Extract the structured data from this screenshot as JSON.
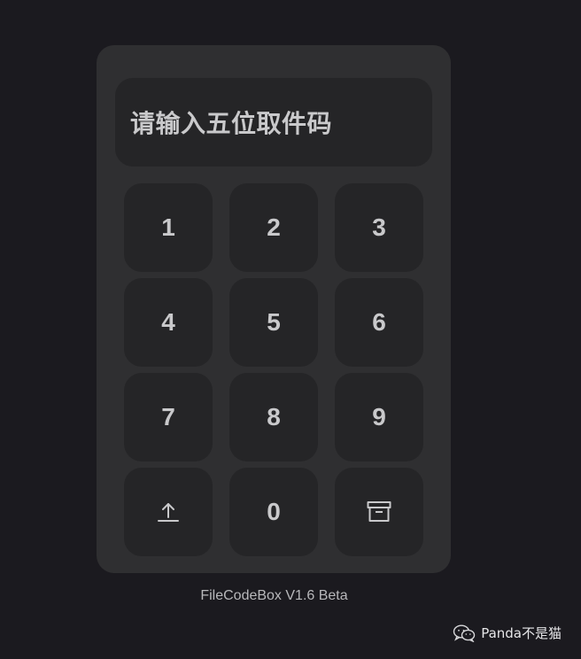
{
  "display": {
    "placeholder": "请输入五位取件码"
  },
  "keypad": {
    "keys": [
      {
        "label": "1",
        "name": "key-1"
      },
      {
        "label": "2",
        "name": "key-2"
      },
      {
        "label": "3",
        "name": "key-3"
      },
      {
        "label": "4",
        "name": "key-4"
      },
      {
        "label": "5",
        "name": "key-5"
      },
      {
        "label": "6",
        "name": "key-6"
      },
      {
        "label": "7",
        "name": "key-7"
      },
      {
        "label": "8",
        "name": "key-8"
      },
      {
        "label": "9",
        "name": "key-9"
      },
      {
        "icon": "upload-icon",
        "name": "upload-button"
      },
      {
        "label": "0",
        "name": "key-0"
      },
      {
        "icon": "archive-box-icon",
        "name": "archive-button"
      }
    ]
  },
  "footer": {
    "version_text": "FileCodeBox V1.6 Beta"
  },
  "watermark": {
    "icon": "wechat-icon",
    "text": "Panda不是猫"
  },
  "colors": {
    "page_background": "#1b1a1f",
    "card_background": "#2f2f31",
    "key_background": "#252527",
    "key_text": "#c9c9cb"
  }
}
